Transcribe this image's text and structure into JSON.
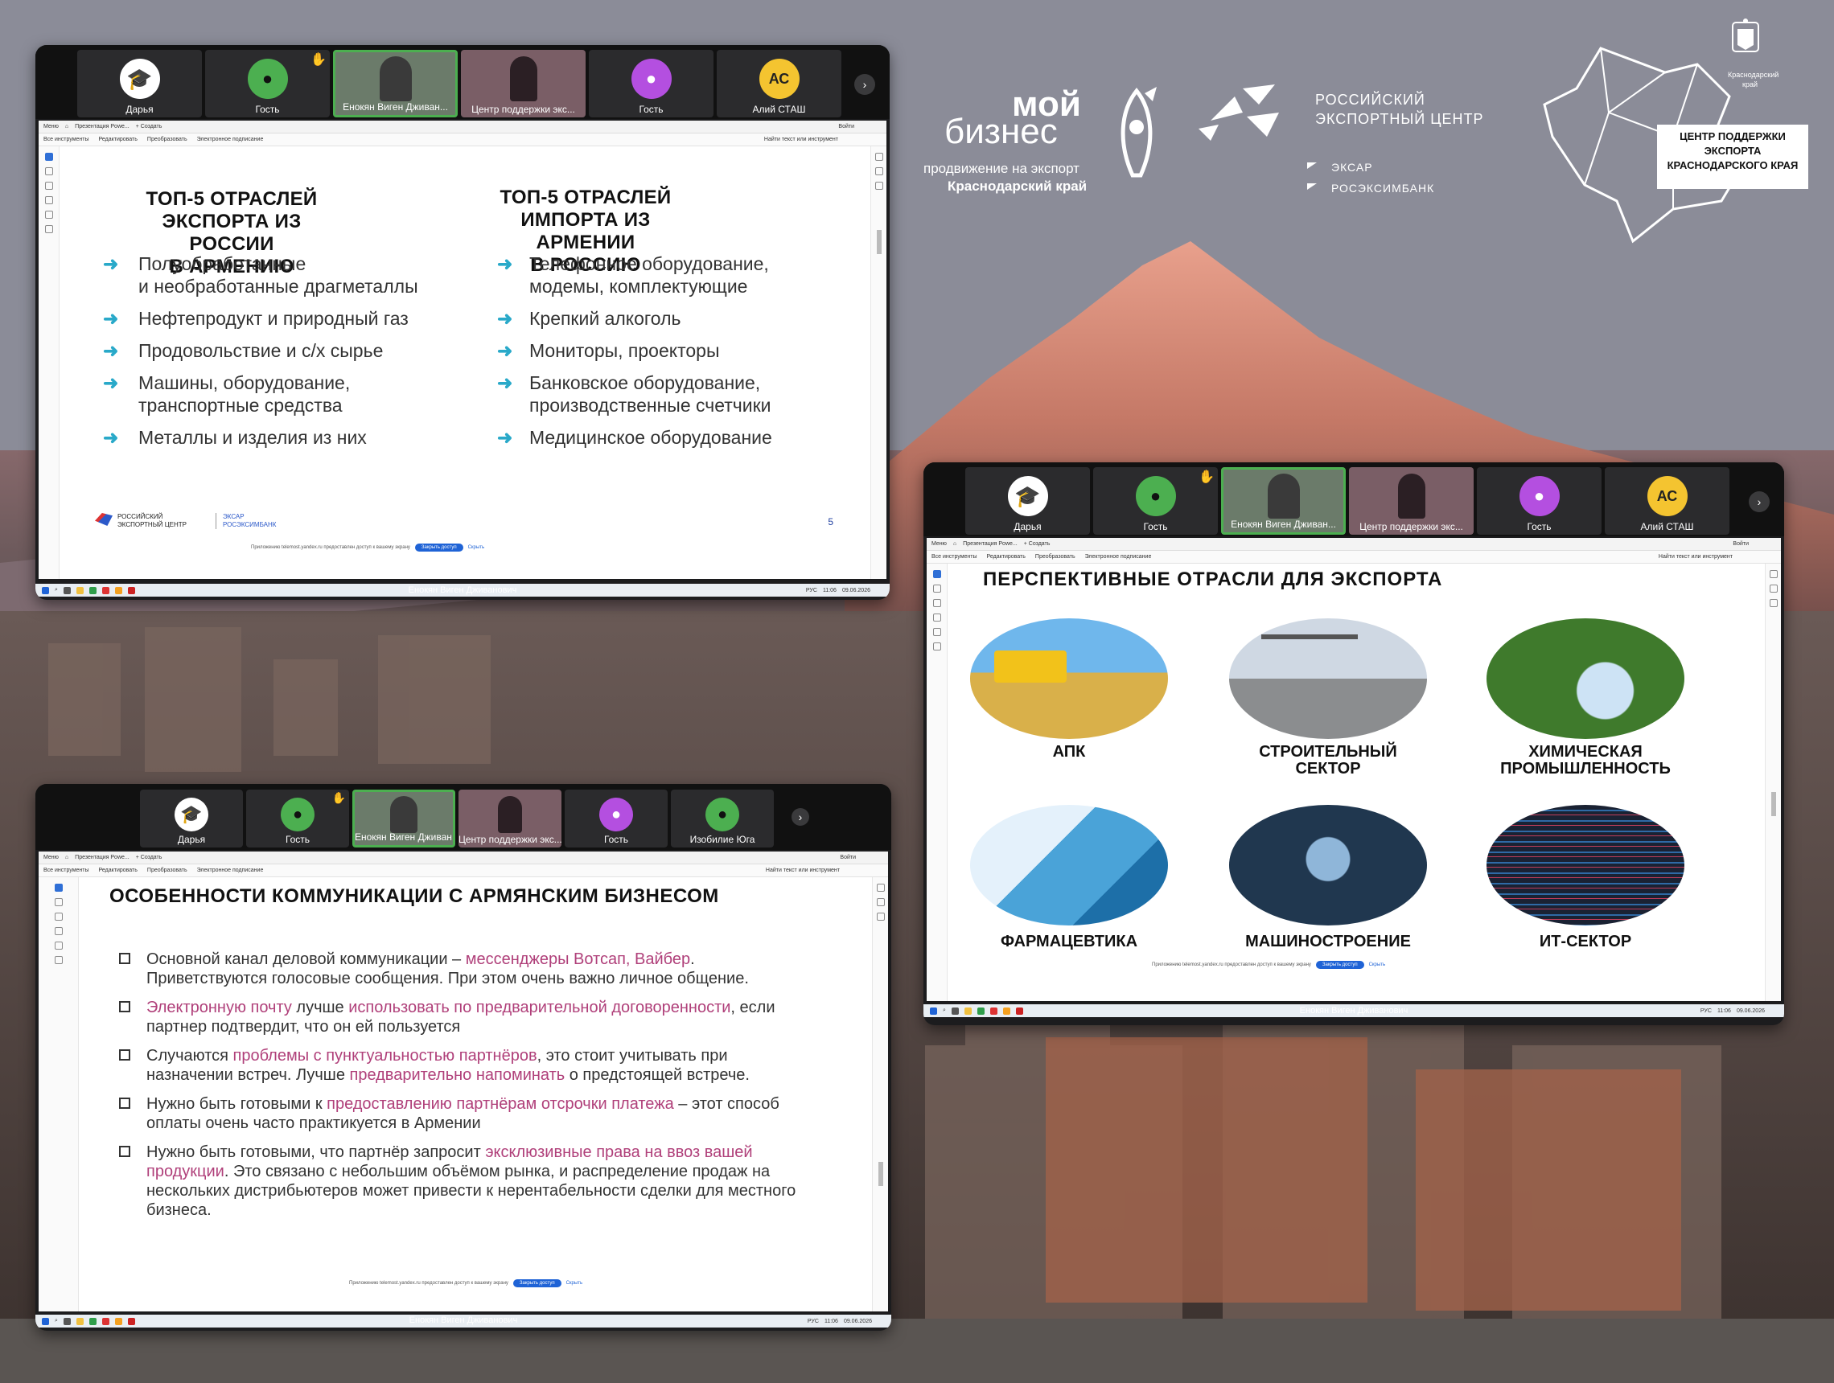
{
  "brand": {
    "moy_biznes_line1": "мой",
    "moy_biznes_line2": "бизнес",
    "moy_biznes_sub1": "продвижение на экспорт",
    "moy_biznes_sub2": "Краснодарский край",
    "rec_line1": "РОССИЙСКИЙ",
    "rec_line2": "ЭКСПОРТНЫЙ ЦЕНТР",
    "eksar": "ЭКСАР",
    "roseximbank": "РОСЭКСИМБАНК",
    "region_caption_line1": "Краснодарский",
    "region_caption_line2": "край",
    "center_line1": "ЦЕНТР ПОДДЕРЖКИ",
    "center_line2": "ЭКСПОРТА",
    "center_line3": "КРАСНОДАРСКОГО КРАЯ"
  },
  "participants_a": [
    {
      "name": "Дарья",
      "initials": "",
      "color": "#ffffff"
    },
    {
      "name": "Гость",
      "initials": "",
      "color": "#4caf50"
    },
    {
      "name": "Енокян Виген Дживан...",
      "initials": "",
      "color": "#6b7b6a"
    },
    {
      "name": "Центр поддержки экс...",
      "initials": "",
      "color": "#8c6c6c"
    },
    {
      "name": "Гость",
      "initials": "",
      "color": "#b44fe0"
    },
    {
      "name": "Алий СТАШ",
      "initials": "АС",
      "color": "#f4c430"
    }
  ],
  "participants_c": [
    {
      "name": "Дарья",
      "initials": "",
      "color": "#ffffff"
    },
    {
      "name": "Гость",
      "initials": "",
      "color": "#4caf50"
    },
    {
      "name": "Енокян Виген Дживан...",
      "initials": "",
      "color": "#6b7b6a"
    },
    {
      "name": "Центр поддержки экс...",
      "initials": "",
      "color": "#8c6c6c"
    },
    {
      "name": "Гость",
      "initials": "",
      "color": "#b44fe0"
    },
    {
      "name": "Изобилие Юга",
      "initials": "",
      "color": "#4caf50"
    }
  ],
  "viewer": {
    "menu": "Меню",
    "tab": "Презентация Powe...",
    "new_tab": "+ Создать",
    "login": "Войти",
    "tools": [
      "Все инструменты",
      "Редактировать",
      "Преобразовать",
      "Электронное подписание"
    ],
    "search": "Найти текст или инструмент"
  },
  "notice": {
    "text": "Приложению telemost.yandex.ru предоставлен доступ к вашему экрану",
    "button": "Закрыть доступ",
    "hide": "Скрыть"
  },
  "presenter": "Енокян Виген Дживанович",
  "taskbar_time": "11:06",
  "taskbar_date": "09.06.2026",
  "taskbar_lang": "РУС",
  "slide_a": {
    "left_title": [
      "ТОП-5 ОТРАСЛЕЙ",
      "ЭКСПОРТА ИЗ РОССИИ",
      "В АРМЕНИЮ"
    ],
    "right_title": [
      "ТОП-5 ОТРАСЛЕЙ",
      "ИМПОРТА ИЗ АРМЕНИИ",
      "В РОССИЮ"
    ],
    "left_items": [
      [
        "Полуобработанные",
        "и необработанные драгметаллы"
      ],
      [
        "Нефтепродукт и природный газ"
      ],
      [
        "Продовольствие и с/х сырье"
      ],
      [
        "Машины, оборудование,",
        "транспортные средства"
      ],
      [
        "Металлы и изделия из них"
      ]
    ],
    "right_items": [
      [
        "Телефонное оборудование,",
        "модемы, комплектующие"
      ],
      [
        "Крепкий алкоголь"
      ],
      [
        "Мониторы, проекторы"
      ],
      [
        "Банковское оборудование,",
        "производственные счетчики"
      ],
      [
        "Медицинское оборудование"
      ]
    ],
    "footer_rec1": "РОССИЙСКИЙ",
    "footer_rec2": "ЭКСПОРТНЫЙ ЦЕНТР",
    "footer_eksar": "ЭКСАР",
    "footer_rosexim": "РОСЭКСИМБАНК",
    "page_no": "5"
  },
  "slide_b": {
    "title": "ПЕРСПЕКТИВНЫЕ ОТРАСЛИ ДЛЯ ЭКСПОРТА",
    "sectors": [
      [
        "АПК"
      ],
      [
        "СТРОИТЕЛЬНЫЙ",
        "СЕКТОР"
      ],
      [
        "ХИМИЧЕСКАЯ",
        "ПРОМЫШЛЕННОСТЬ"
      ],
      [
        "ФАРМАЦЕВТИКА"
      ],
      [
        "МАШИНОСТРОЕНИЕ"
      ],
      [
        "ИТ-СЕКТОР"
      ]
    ]
  },
  "slide_c": {
    "title": "ОСОБЕННОСТИ КОММУНИКАЦИИ С АРМЯНСКИМ БИЗНЕСОМ",
    "items": [
      [
        {
          "t": "Основной канал деловой коммуникации – ",
          "h": false
        },
        {
          "t": "мессенджеры Вотсап, Вайбер",
          "h": true
        },
        {
          "t": ". Приветствуются голосовые сообщения. При этом очень важно личное общение.",
          "h": false
        }
      ],
      [
        {
          "t": "Электронную почту",
          "h": true
        },
        {
          "t": " лучше ",
          "h": false
        },
        {
          "t": "использовать по предварительной договоренности",
          "h": true
        },
        {
          "t": ", если партнер подтвердит, что он ей пользуется",
          "h": false
        }
      ],
      [
        {
          "t": "Случаются ",
          "h": false
        },
        {
          "t": "проблемы с пунктуальностью партнёров",
          "h": true
        },
        {
          "t": ", это стоит учитывать при назначении встреч. Лучше ",
          "h": false
        },
        {
          "t": "предварительно напоминать",
          "h": true
        },
        {
          "t": " о предстоящей встрече.",
          "h": false
        }
      ],
      [
        {
          "t": "Нужно быть готовыми к ",
          "h": false
        },
        {
          "t": "предоставлению партнёрам отсрочки платежа",
          "h": true
        },
        {
          "t": " – этот способ оплаты  очень часто практикуется в Армении",
          "h": false
        }
      ],
      [
        {
          "t": "Нужно быть готовыми, что партнёр запросит ",
          "h": false
        },
        {
          "t": "эксклюзивные права на ввоз вашей продукции",
          "h": true
        },
        {
          "t": ". Это связано с небольшим объёмом рынка, и распределение продаж на нескольких дистрибьютеров может привести к нерентабельности сделки для местного бизнеса.",
          "h": false
        }
      ]
    ]
  },
  "colors": {
    "accent_arrow": "#29a9c9",
    "highlight": "#b0407a",
    "active_tile": "#4caf50",
    "button_blue": "#1f63d6"
  }
}
